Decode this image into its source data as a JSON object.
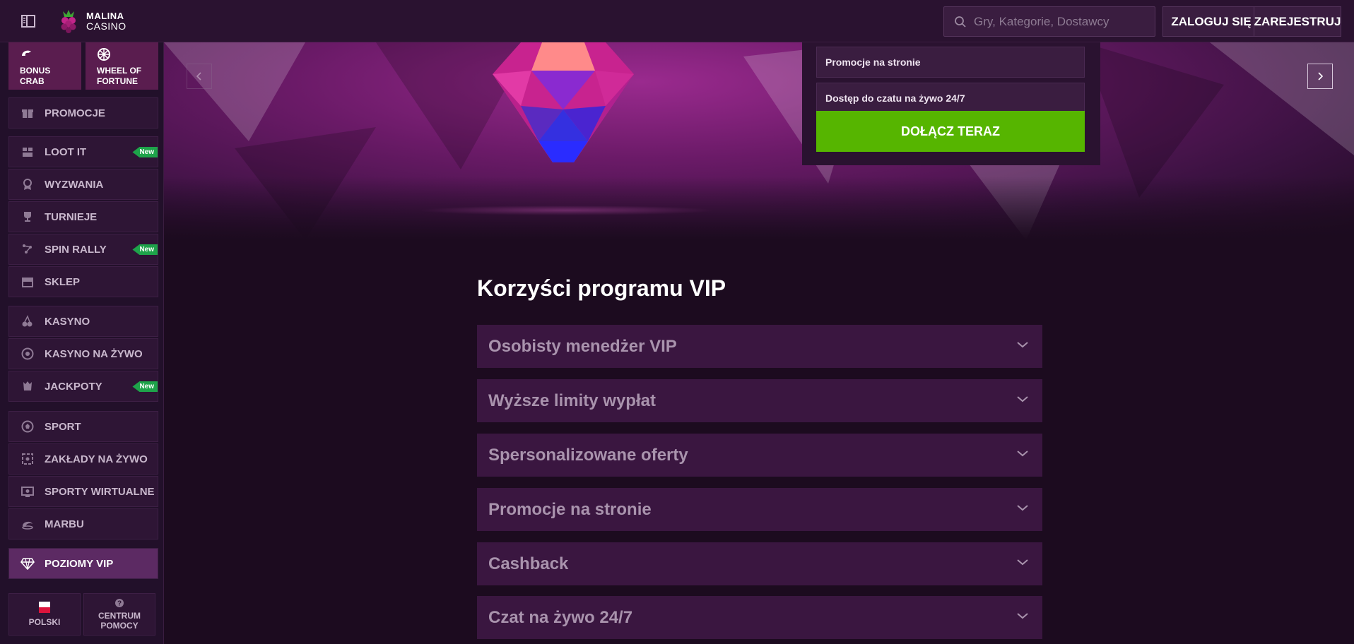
{
  "header": {
    "logo_line1": "MALINA",
    "logo_line2": "CASINO",
    "search_placeholder": "Gry, Kategorie, Dostawcy",
    "login_label": "ZALOGUJ SIĘ",
    "register_label": "ZAREJESTRUJ"
  },
  "sidebar": {
    "tiles": [
      {
        "label_line1": "BONUS",
        "label_line2": "CRAB",
        "icon": "crab-icon"
      },
      {
        "label_line1": "WHEEL OF",
        "label_line2": "FORTUNE",
        "icon": "wheel-icon"
      }
    ],
    "items": [
      {
        "label": "PROMOCJE",
        "icon": "gift-icon"
      },
      {
        "label": "LOOT IT",
        "icon": "box-icon",
        "badge": "New"
      },
      {
        "label": "WYZWANIA",
        "icon": "medal-icon"
      },
      {
        "label": "TURNIEJE",
        "icon": "trophy-icon"
      },
      {
        "label": "SPIN RALLY",
        "icon": "rally-icon",
        "badge": "New"
      },
      {
        "label": "SKLEP",
        "icon": "shop-icon"
      },
      {
        "label": "KASYNO",
        "icon": "cherries-icon"
      },
      {
        "label": "KASYNO NA ŻYWO",
        "icon": "chip-icon"
      },
      {
        "label": "JACKPOTY",
        "icon": "jackpot-icon",
        "badge": "New"
      },
      {
        "label": "SPORT",
        "icon": "soccer-ball-icon"
      },
      {
        "label": "ZAKŁADY NA ŻYWO",
        "icon": "live-bets-icon"
      },
      {
        "label": "SPORTY WIRTUALNE",
        "icon": "virtual-sports-icon"
      },
      {
        "label": "MARBU",
        "icon": "marbu-icon"
      },
      {
        "label": "POZIOMY VIP",
        "icon": "diamond-icon",
        "active": true
      }
    ],
    "language_label": "POLSKI",
    "help_label_line1": "CENTRUM",
    "help_label_line2": "POMOCY"
  },
  "hero": {
    "benefits_visible": [
      "Promocje na stronie",
      "Dostęp do czatu na żywo 24/7"
    ],
    "join_button": "DOŁĄCZ TERAZ"
  },
  "vip": {
    "title": "Korzyści programu VIP",
    "accordion": [
      "Osobisty menedżer VIP",
      "Wyższe limity wypłat",
      "Spersonalizowane oferty",
      "Promocje na stronie",
      "Cashback",
      "Czat na żywo 24/7"
    ]
  },
  "colors": {
    "background": "#1c0b1f",
    "header": "#2a1230",
    "accent_green": "#56b500",
    "badge_green": "#1ea34a",
    "accordion_bg": "#3a1640",
    "accordion_text": "#a993ad"
  }
}
